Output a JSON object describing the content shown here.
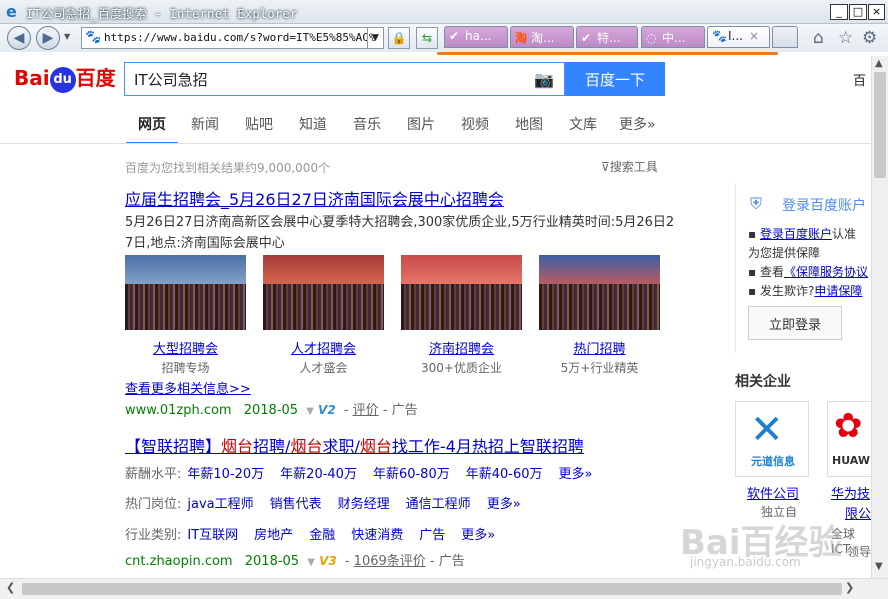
{
  "window": {
    "title": "IT公司急招_百度搜索 - Internet Explorer",
    "min": "_",
    "max": "□",
    "close": "×"
  },
  "browser": {
    "address": "https://www.baidu.com/s?word=IT%E5%85%AC%",
    "tabs": [
      {
        "icon": "✔",
        "label": "ha..."
      },
      {
        "icon": "淘",
        "label": "淘..."
      },
      {
        "icon": "✔",
        "label": "特..."
      },
      {
        "icon": "◌",
        "label": "中..."
      },
      {
        "icon": "🐾",
        "label": "I..."
      }
    ]
  },
  "baidu": {
    "logo_a": "Bai",
    "logo_du": "du",
    "logo_b": "百度",
    "query": "IT公司急招",
    "search_button": "百度一下",
    "top_right": "百",
    "nav": [
      "网页",
      "新闻",
      "贴吧",
      "知道",
      "音乐",
      "图片",
      "视频",
      "地图",
      "文库",
      "更多»"
    ],
    "result_count": "百度为您找到相关结果约9,000,000个",
    "tools": "搜索工具"
  },
  "result1": {
    "title": "应届生招聘会_5月26日27日济南国际会展中心招聘会",
    "desc1": "5月26日27日济南高新区会展中心夏季特大招聘会,300家优质企业,5万行业精英时间:5月26日2",
    "desc2": "7日,地点:济南国际会展中心",
    "images": [
      {
        "link": "大型招聘会",
        "sub": "招聘专场"
      },
      {
        "link": "人才招聘会",
        "sub": "人才盛会"
      },
      {
        "link": "济南招聘会",
        "sub": "300+优质企业"
      },
      {
        "link": "热门招聘",
        "sub": "5万+行业精英"
      }
    ],
    "more": "查看更多相关信息>>",
    "url": "www.01zph.com",
    "date": "2018-05",
    "v": "V2",
    "eval": "评价",
    "ad": "- 广告"
  },
  "result2": {
    "title_a": "【智联招聘】",
    "title_b": "烟台",
    "title_c": "招聘/",
    "title_d": "烟台",
    "title_e": "求职/",
    "title_f": "烟台",
    "title_g": "找工作-4月热招上智联招聘",
    "salary_label": "薪酬水平:",
    "salary": [
      "年薪10-20万",
      "年薪20-40万",
      "年薪60-80万",
      "年薪40-60万",
      "更多»"
    ],
    "pos_label": "热门岗位:",
    "pos": [
      "java工程师",
      "销售代表",
      "财务经理",
      "通信工程师",
      "更多»"
    ],
    "ind_label": "行业类别:",
    "ind": [
      "IT互联网",
      "房地产",
      "金融",
      "快速消费",
      "广告",
      "更多»"
    ],
    "url": "cnt.zhaopin.com",
    "date": "2018-05",
    "v": "V3",
    "eval": "1069条评价",
    "ad": "- 广告"
  },
  "right": {
    "login_title": "登录百度账户",
    "line1a": "登录百度账户",
    "line1b": "认准",
    "line2": "为您提供保障",
    "line3a": "查看",
    "line3b": "《保障服务协议",
    "line4a": "发生欺诈?",
    "line4b": "申请保障",
    "login_btn": "立即登录",
    "related": "相关企业",
    "co1_logo": "元道信息",
    "co1": "软件公司",
    "co1_sub": "独立自",
    "co2_logo": "HUAW",
    "co2": "华为技",
    "co2_sub": "限公",
    "co2_line": "全球ICT",
    "co2_line2": "领导"
  },
  "watermark": {
    "text": "Bai百经验",
    "sub": "jingyan.baidu.com"
  }
}
